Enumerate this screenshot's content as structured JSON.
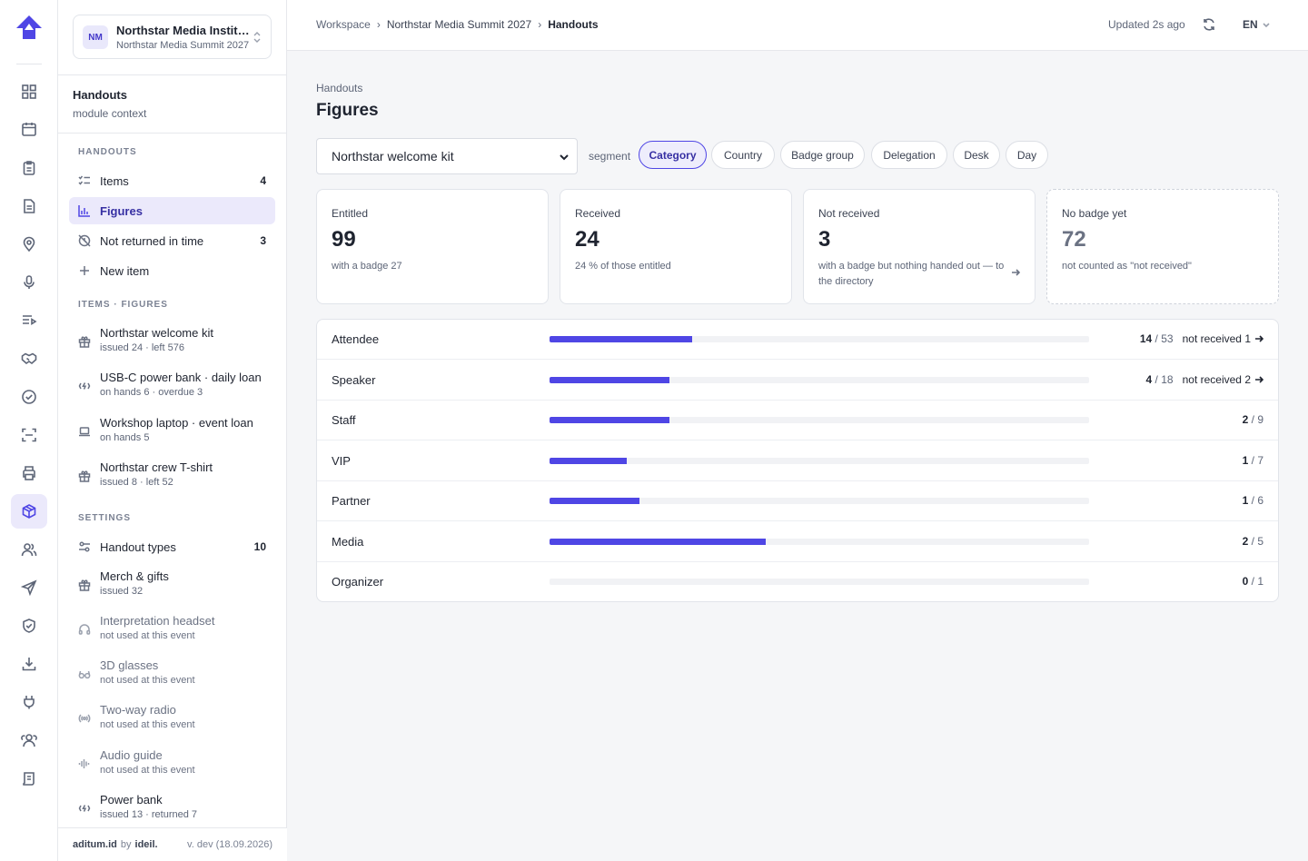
{
  "rail": {
    "items": [
      "dashboard-icon",
      "calendar-icon",
      "clipboard-icon",
      "document-icon",
      "map-pin-icon",
      "microphone-icon",
      "agenda-icon",
      "handshake-icon",
      "check-circle-icon",
      "scan-icon",
      "printer-icon",
      "box-icon",
      "users-icon",
      "send-icon",
      "shield-icon",
      "download-icon",
      "plug-icon",
      "team-icon",
      "log-icon"
    ],
    "active": "box-icon"
  },
  "org": {
    "initials": "NM",
    "name": "Northstar Media Institute",
    "event": "Northstar Media Summit 2027"
  },
  "context": {
    "title": "Handouts",
    "subtitle": "module context"
  },
  "sections": {
    "handouts": "HANDOUTS",
    "items_figures": "ITEMS · FIGURES",
    "settings": "SETTINGS"
  },
  "nav": {
    "items": {
      "label": "Items",
      "count": "4"
    },
    "figures": {
      "label": "Figures"
    },
    "not_returned": {
      "label": "Not returned in time",
      "count": "3"
    },
    "new_item": {
      "label": "New item"
    }
  },
  "item_list": [
    {
      "name": "Northstar welcome kit",
      "meta": "issued 24 · left 576",
      "icon": "gift-icon"
    },
    {
      "name": "USB-C power bank · daily loan",
      "meta": "on hands 6 · overdue 3",
      "icon": "battery-icon"
    },
    {
      "name": "Workshop laptop · event loan",
      "meta": "on hands 5",
      "icon": "laptop-icon"
    },
    {
      "name": "Northstar crew T-shirt",
      "meta": "issued 8 · left 52",
      "icon": "gift-icon"
    }
  ],
  "settings": {
    "handout_types": {
      "label": "Handout types",
      "count": "10"
    },
    "list": [
      {
        "name": "Merch & gifts",
        "meta": "issued 32",
        "icon": "gift-icon",
        "muted": false
      },
      {
        "name": "Interpretation headset",
        "meta": "not used at this event",
        "icon": "headset-icon",
        "muted": true
      },
      {
        "name": "3D glasses",
        "meta": "not used at this event",
        "icon": "glasses-icon",
        "muted": true
      },
      {
        "name": "Two-way radio",
        "meta": "not used at this event",
        "icon": "radio-icon",
        "muted": true
      },
      {
        "name": "Audio guide",
        "meta": "not used at this event",
        "icon": "audio-wave-icon",
        "muted": true
      },
      {
        "name": "Power bank",
        "meta": "issued 13 · returned 7",
        "icon": "battery-icon",
        "muted": false
      }
    ]
  },
  "footer": {
    "brand": "aditum.id",
    "by": "by",
    "maker": "ideil.",
    "version": "v. dev (18.09.2026)"
  },
  "breadcrumb": {
    "root": "Workspace",
    "event": "Northstar Media Summit 2027",
    "current": "Handouts",
    "separator": "›"
  },
  "status": {
    "updated": "Updated 2s ago",
    "language": "EN"
  },
  "page": {
    "eyebrow": "Handouts",
    "title": "Figures"
  },
  "filter": {
    "selected_item": "Northstar welcome kit",
    "segment_label": "segment",
    "segments": [
      "Category",
      "Country",
      "Badge group",
      "Delegation",
      "Desk",
      "Day"
    ],
    "active_segment": "Category"
  },
  "cards": [
    {
      "label": "Entitled",
      "value": "99",
      "note": "with a badge 27",
      "dashed": false,
      "link": false
    },
    {
      "label": "Received",
      "value": "24",
      "note": "24 % of those entitled",
      "dashed": false,
      "link": false
    },
    {
      "label": "Not received",
      "value": "3",
      "note": "with a badge but nothing handed out — to the directory",
      "dashed": false,
      "link": true
    },
    {
      "label": "No badge yet",
      "value": "72",
      "note": "not counted as \"not received\"",
      "dashed": true,
      "link": false
    }
  ],
  "breakdown": {
    "not_received_label": "not received",
    "rows": [
      {
        "category": "Attendee",
        "received": 14,
        "total": 53,
        "not_received": 1
      },
      {
        "category": "Speaker",
        "received": 4,
        "total": 18,
        "not_received": 2
      },
      {
        "category": "Staff",
        "received": 2,
        "total": 9,
        "not_received": 0
      },
      {
        "category": "VIP",
        "received": 1,
        "total": 7,
        "not_received": 0
      },
      {
        "category": "Partner",
        "received": 1,
        "total": 6,
        "not_received": 0
      },
      {
        "category": "Media",
        "received": 2,
        "total": 5,
        "not_received": 0
      },
      {
        "category": "Organizer",
        "received": 0,
        "total": 1,
        "not_received": 0
      }
    ]
  },
  "colors": {
    "accent": "#4f46e5",
    "accent_soft": "#ebe9fb",
    "track": "#f1f2f5"
  }
}
